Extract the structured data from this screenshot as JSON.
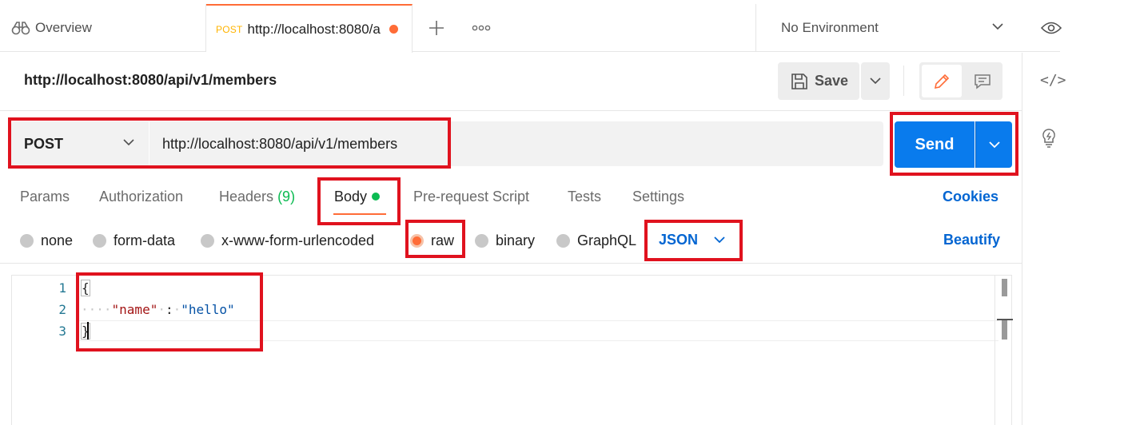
{
  "tabs": {
    "overview": "Overview",
    "active_method": "POST",
    "active_url": "http://localhost:8080/api/v1/members"
  },
  "environment": {
    "label": "No Environment"
  },
  "request": {
    "title": "http://localhost:8080/api/v1/members",
    "save_label": "Save",
    "method": "POST",
    "url": "http://localhost:8080/api/v1/members",
    "send_label": "Send"
  },
  "subtabs": {
    "params": "Params",
    "authorization": "Authorization",
    "headers": "Headers",
    "headers_count": "(9)",
    "body": "Body",
    "prerequest": "Pre-request Script",
    "tests": "Tests",
    "settings": "Settings",
    "cookies": "Cookies"
  },
  "body_types": {
    "none": "none",
    "form_data": "form-data",
    "urlencoded": "x-www-form-urlencoded",
    "raw": "raw",
    "binary": "binary",
    "graphql": "GraphQL",
    "selected": "raw",
    "format": "JSON",
    "beautify": "Beautify"
  },
  "editor": {
    "line_numbers": [
      "1",
      "2",
      "3"
    ],
    "open_brace": "{",
    "key": "\"name\"",
    "colon": ":",
    "value": "\"hello\"",
    "close_brace": "}"
  },
  "colors": {
    "accent": "#ff6c37",
    "send": "#097bed",
    "link": "#0265d2",
    "annotation": "#e0121e",
    "success": "#0cbb52"
  },
  "icons": [
    "binoculars-icon",
    "plus-icon",
    "more-icon",
    "chevron-down-icon",
    "eye-icon",
    "save-icon",
    "pencil-icon",
    "comment-icon",
    "code-icon",
    "lightbulb-icon"
  ]
}
